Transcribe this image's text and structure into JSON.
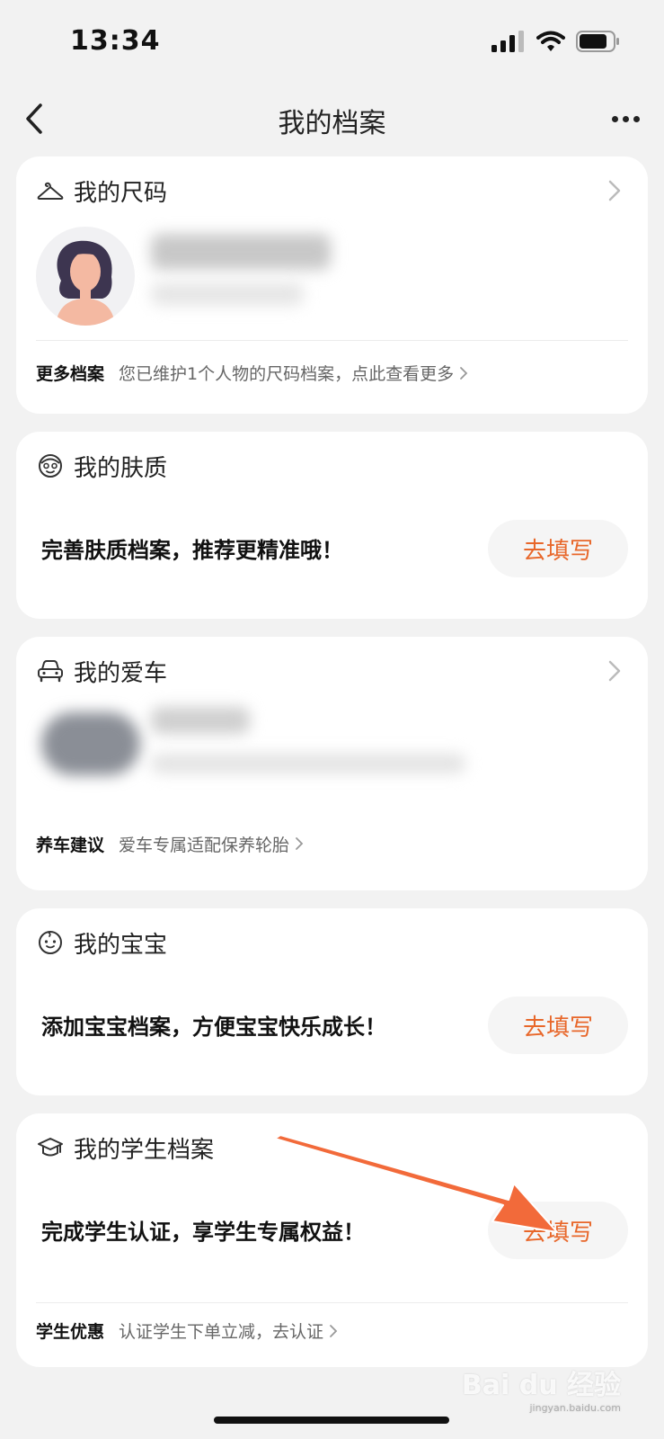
{
  "status": {
    "time": "13:34"
  },
  "nav": {
    "title": "我的档案"
  },
  "size_card": {
    "title": "我的尺码",
    "footer_label": "更多档案",
    "footer_text": "您已维护1个人物的尺码档案，点此查看更多"
  },
  "skin_card": {
    "title": "我的肤质",
    "prompt": "完善肤质档案，推荐更精准哦！",
    "button": "去填写"
  },
  "car_card": {
    "title": "我的爱车",
    "footer_label": "养车建议",
    "footer_text": "爱车专属适配保养轮胎"
  },
  "baby_card": {
    "title": "我的宝宝",
    "prompt": "添加宝宝档案，方便宝宝快乐成长！",
    "button": "去填写"
  },
  "student_card": {
    "title": "我的学生档案",
    "prompt": "完成学生认证，享学生专属权益！",
    "button": "去填写",
    "footer_label": "学生优惠",
    "footer_text": "认证学生下单立减，去认证"
  },
  "watermark": {
    "brand": "Bai du 经验",
    "url": "jingyan.baidu.com"
  },
  "colors": {
    "accent": "#e8672a",
    "arrow": "#f26a3a",
    "background": "#f2f2f2"
  },
  "icons": [
    "back-chevron-icon",
    "more-icon",
    "hanger-icon",
    "face-icon",
    "car-icon",
    "baby-icon",
    "graduation-cap-icon",
    "chevron-right-icon"
  ]
}
